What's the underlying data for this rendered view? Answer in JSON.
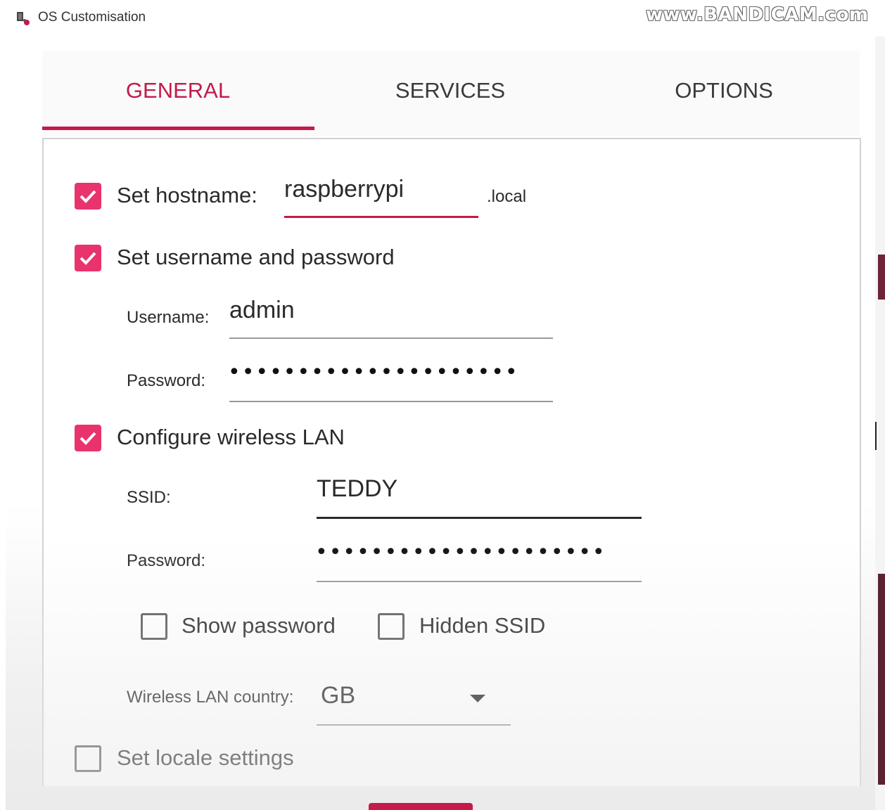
{
  "window": {
    "title": "OS Customisation",
    "watermark": "www.BANDICAM.com"
  },
  "tabs": [
    {
      "label": "GENERAL",
      "active": true
    },
    {
      "label": "SERVICES",
      "active": false
    },
    {
      "label": "OPTIONS",
      "active": false
    }
  ],
  "general": {
    "hostname": {
      "label": "Set hostname:",
      "checked": true,
      "value": "raspberrypi",
      "suffix": ".local"
    },
    "user": {
      "label": "Set username and password",
      "checked": true,
      "username_label": "Username:",
      "username_value": "admin",
      "password_label": "Password:",
      "password_mask": "•••••••••••••••••••••"
    },
    "wlan": {
      "label": "Configure wireless LAN",
      "checked": true,
      "ssid_label": "SSID:",
      "ssid_value": "TEDDY",
      "password_label": "Password:",
      "password_mask": "•••••••••••••••••••••",
      "show_password_label": "Show password",
      "show_password_checked": false,
      "hidden_ssid_label": "Hidden SSID",
      "hidden_ssid_checked": false,
      "country_label": "Wireless LAN country:",
      "country_value": "GB"
    },
    "locale": {
      "label": "Set locale settings",
      "checked": false
    }
  },
  "colors": {
    "accent": "#c51a4a",
    "checkbox": "#e8336d"
  }
}
